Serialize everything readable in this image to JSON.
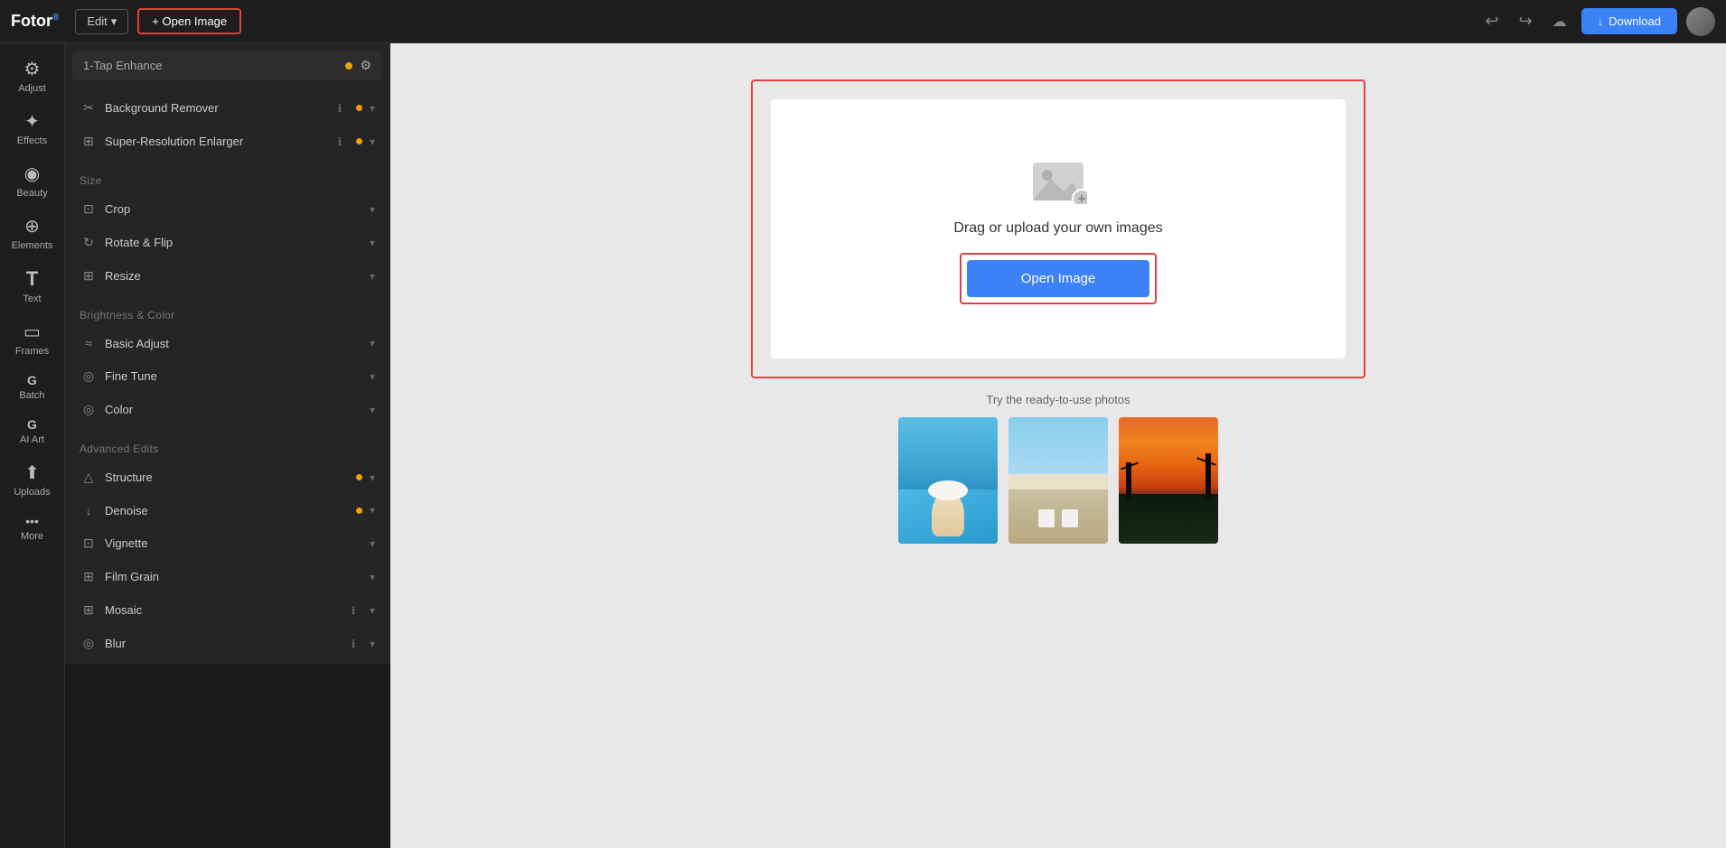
{
  "topbar": {
    "logo": "Fotor",
    "edit_label": "Edit",
    "open_image_label": "+ Open Image",
    "download_label": "Download"
  },
  "nav": {
    "items": [
      {
        "id": "adjust",
        "icon": "⚙",
        "label": "Adjust"
      },
      {
        "id": "effects",
        "icon": "✨",
        "label": "Effects"
      },
      {
        "id": "beauty",
        "icon": "👁",
        "label": "Beauty"
      },
      {
        "id": "elements",
        "icon": "➕",
        "label": "Elements"
      },
      {
        "id": "text",
        "icon": "T",
        "label": "Text"
      },
      {
        "id": "frames",
        "icon": "▭",
        "label": "Frames"
      },
      {
        "id": "batch",
        "icon": "G",
        "label": "Batch"
      },
      {
        "id": "ai-art",
        "icon": "G",
        "label": "AI Art"
      },
      {
        "id": "uploads",
        "icon": "↑",
        "label": "Uploads"
      },
      {
        "id": "more",
        "icon": "···",
        "label": "More"
      }
    ]
  },
  "panel": {
    "enhance_placeholder": "1-Tap Enhance",
    "sections": [
      {
        "title": null,
        "items": [
          {
            "id": "background-remover",
            "icon": "✂",
            "label": "Background Remover",
            "has_info": true,
            "has_dot": true
          },
          {
            "id": "super-resolution",
            "icon": "⊞",
            "label": "Super-Resolution Enlarger",
            "has_info": true,
            "has_dot": true
          }
        ]
      },
      {
        "title": "Size",
        "items": [
          {
            "id": "crop",
            "icon": "⊡",
            "label": "Crop"
          },
          {
            "id": "rotate-flip",
            "icon": "↻",
            "label": "Rotate & Flip"
          },
          {
            "id": "resize",
            "icon": "⊞",
            "label": "Resize"
          }
        ]
      },
      {
        "title": "Brightness & Color",
        "items": [
          {
            "id": "basic-adjust",
            "icon": "≈",
            "label": "Basic Adjust"
          },
          {
            "id": "fine-tune",
            "icon": "◎",
            "label": "Fine Tune"
          },
          {
            "id": "color",
            "icon": "◎",
            "label": "Color"
          }
        ]
      },
      {
        "title": "Advanced Edits",
        "items": [
          {
            "id": "structure",
            "icon": "△",
            "label": "Structure",
            "has_dot": true
          },
          {
            "id": "denoise",
            "icon": "↓",
            "label": "Denoise",
            "has_dot": true
          },
          {
            "id": "vignette",
            "icon": "⊡",
            "label": "Vignette"
          },
          {
            "id": "film-grain",
            "icon": "⊞",
            "label": "Film Grain"
          },
          {
            "id": "mosaic",
            "icon": "⊞",
            "label": "Mosaic",
            "has_info": true
          },
          {
            "id": "blur",
            "icon": "◎",
            "label": "Blur",
            "has_info": true
          }
        ]
      }
    ]
  },
  "canvas": {
    "upload_text": "Drag or upload your own images",
    "open_image_label": "Open Image",
    "ready_photos_text": "Try the ready-to-use photos"
  }
}
